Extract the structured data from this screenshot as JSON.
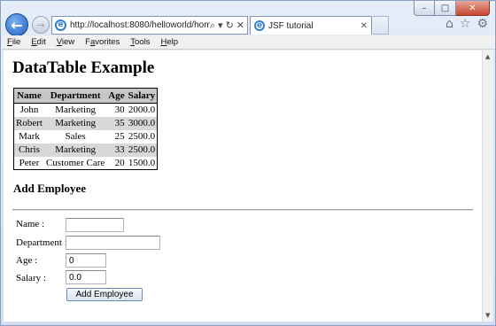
{
  "browser": {
    "url": "http://localhost:8080/helloworld/home.jsf",
    "tab_title": "JSF tutorial",
    "menu": [
      "File",
      "Edit",
      "View",
      "Favorites",
      "Tools",
      "Help"
    ],
    "menu_mnemonics": [
      "F",
      "E",
      "V",
      "a",
      "T",
      "H"
    ]
  },
  "page": {
    "heading": "DataTable Example",
    "table": {
      "headers": [
        "Name",
        "Department",
        "Age",
        "Salary"
      ],
      "rows": [
        [
          "John",
          "Marketing",
          "30",
          "2000.0"
        ],
        [
          "Robert",
          "Marketing",
          "35",
          "3000.0"
        ],
        [
          "Mark",
          "Sales",
          "25",
          "2500.0"
        ],
        [
          "Chris",
          "Marketing",
          "33",
          "2500.0"
        ],
        [
          "Peter",
          "Customer Care",
          "20",
          "1500.0"
        ]
      ]
    },
    "form": {
      "title": "Add Employee",
      "name_label": "Name :",
      "name_value": "",
      "department_label": "Department :",
      "department_value": "",
      "age_label": "Age :",
      "age_value": "0",
      "salary_label": "Salary :",
      "salary_value": "0.0",
      "submit_label": "Add Employee"
    }
  },
  "icons": {
    "back": "back-arrow-icon",
    "forward": "forward-arrow-icon",
    "home": "home-icon",
    "favorites": "star-icon",
    "tools": "gear-icon"
  },
  "colors": {
    "header_bg": "#c6c6c6",
    "even_row_bg": "#d8d8d8",
    "browser_frame": "#dbe6f3"
  }
}
